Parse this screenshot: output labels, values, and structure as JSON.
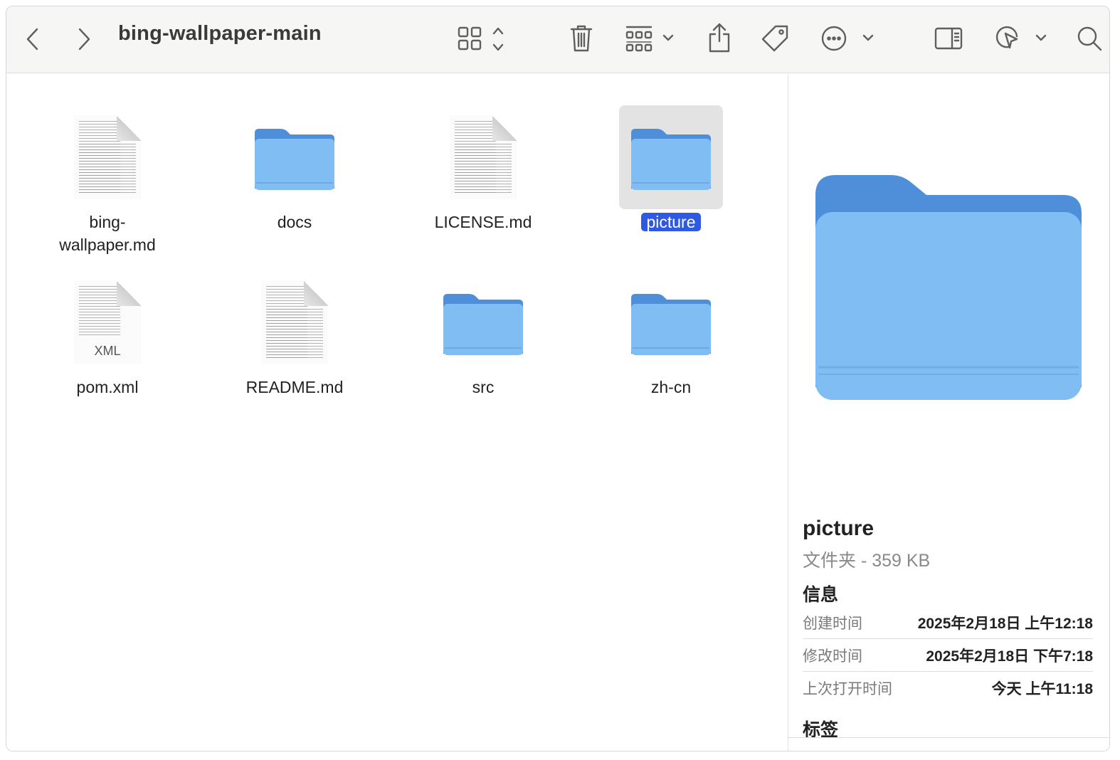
{
  "window": {
    "title": "bing-wallpaper-main"
  },
  "toolbar": {
    "icons": [
      "chevron-left-icon",
      "chevron-right-icon",
      "icon-grid-view-icon",
      "trash-icon",
      "group-icon",
      "share-icon",
      "tag-icon",
      "more-icon",
      "sidebar-icon",
      "markup-icon",
      "search-icon"
    ]
  },
  "files": [
    {
      "name": "bing-wallpaper.md",
      "label_line1": "bing-",
      "label_line2": "wallpaper.md",
      "kind": "doc"
    },
    {
      "name": "docs",
      "label_line1": "docs",
      "kind": "folder"
    },
    {
      "name": "LICENSE.md",
      "label_line1": "LICENSE.md",
      "kind": "doc"
    },
    {
      "name": "picture",
      "label_line1": "picture",
      "kind": "folder",
      "selected": true
    },
    {
      "name": "pom.xml",
      "label_line1": "pom.xml",
      "kind": "xml",
      "badge": "XML"
    },
    {
      "name": "README.md",
      "label_line1": "README.md",
      "kind": "doc"
    },
    {
      "name": "src",
      "label_line1": "src",
      "kind": "folder"
    },
    {
      "name": "zh-cn",
      "label_line1": "zh-cn",
      "kind": "folder"
    }
  ],
  "preview": {
    "name": "picture",
    "subtitle": "文件夹 - 359 KB",
    "info_heading": "信息",
    "info": [
      {
        "key": "创建时间",
        "value": "2025年2月18日 上午12:18"
      },
      {
        "key": "修改时间",
        "value": "2025年2月18日 下午7:18"
      },
      {
        "key": "上次打开时间",
        "value": "今天 上午11:18"
      }
    ],
    "tags_heading": "标签"
  },
  "colors": {
    "folder_front": "#7fbdf2",
    "folder_back": "#4f8fd9",
    "selection": "#2f5ae0"
  }
}
